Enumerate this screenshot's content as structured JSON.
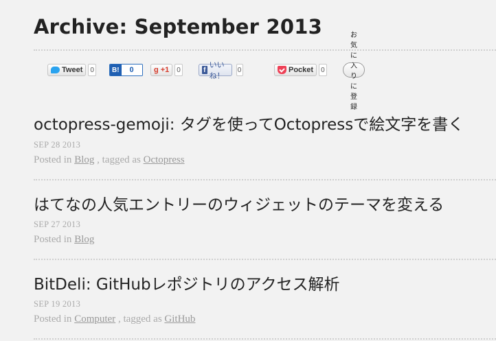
{
  "archive": {
    "title": "Archive: September 2013"
  },
  "share": {
    "tweet": {
      "label": "Tweet",
      "count": "0"
    },
    "hatena": {
      "logo": "B!",
      "count": "0"
    },
    "gplus": {
      "label": "+1",
      "count": "0"
    },
    "facebook": {
      "logo": "f",
      "label": "いいね！",
      "count": "0"
    },
    "pocket": {
      "label": "Pocket",
      "count": "0"
    },
    "favorite": {
      "label": "お気に入りに登録"
    }
  },
  "posts": [
    {
      "title": "octopress-gemoji: タグを使ってOctopressで絵文字を書く",
      "date": "SEP 28 2013",
      "posted_in": "Posted in",
      "category": "Blog",
      "tagged_as": ", tagged as",
      "tag": "Octopress"
    },
    {
      "title": "はてなの人気エントリーのウィジェットのテーマを変える",
      "date": "SEP 27 2013",
      "posted_in": "Posted in",
      "category": "Blog"
    },
    {
      "title": "BitDeli: GitHubレポジトリのアクセス解析",
      "date": "SEP 19 2013",
      "posted_in": "Posted in",
      "category": "Computer",
      "tagged_as": ", tagged as",
      "tag": "GitHub"
    }
  ],
  "colors": {
    "background": "#f2f2f2",
    "text": "#222222",
    "meta": "#aaaaaa",
    "twitter": "#2aa3ef",
    "hatena": "#1f5fb2",
    "gplus": "#d53a2a",
    "facebook": "#3b5998",
    "pocket": "#ee4056"
  }
}
